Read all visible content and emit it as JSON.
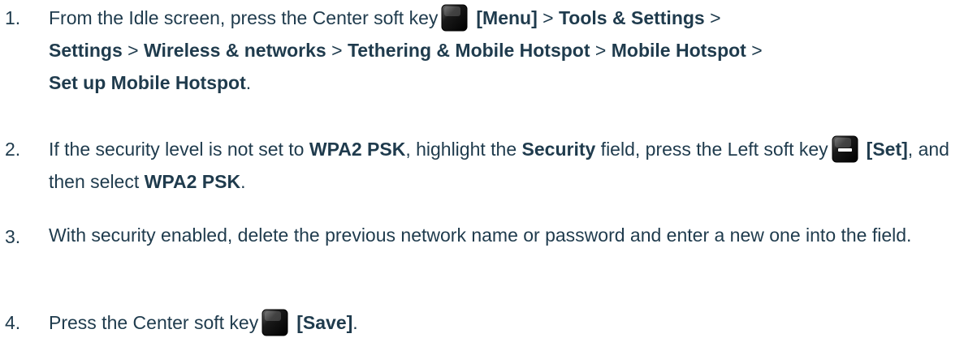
{
  "steps": [
    {
      "number": "1.",
      "p1": "From the Idle screen, press the Center soft key",
      "key_label": "[Menu]",
      "sep1": " > ",
      "b1": "Tools & Settings",
      "sep2": " > ",
      "b2": "Settings",
      "sep3": " > ",
      "b3": "Wireless & networks",
      "sep4": " > ",
      "b4": "Tethering & Mobile Hotspot",
      "sep5": " > ",
      "b5": "Mobile Hotspot",
      "sep6": " > ",
      "b6": "Set up Mobile Hotspot",
      "end": "."
    },
    {
      "number": "2.",
      "p1": "If the security level is not set to ",
      "b1": "WPA2 PSK",
      "p2": ", highlight the ",
      "b2": "Security",
      "p3": " field, press the Left soft key",
      "key_label": "[Set]",
      "p4": ", and then select ",
      "b3": "WPA2 PSK",
      "end": "."
    },
    {
      "number": "3.",
      "text": "With security enabled, delete the previous network name or password and enter a new one into the field."
    },
    {
      "number": "4.",
      "p1": "Press the Center soft key",
      "key_label": "[Save]",
      "end": "."
    }
  ],
  "icons": {
    "center_key": "center-soft-key-icon",
    "left_key": "left-soft-key-icon"
  },
  "colors": {
    "text": "#1f3b4d",
    "key_dark": "#111111"
  }
}
